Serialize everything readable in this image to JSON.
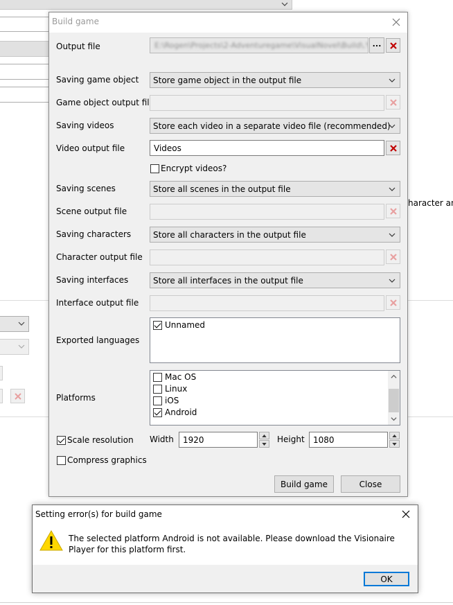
{
  "background": {
    "side_text": "haracter anir"
  },
  "window": {
    "title": "Build game",
    "output_file": {
      "label": "Output file",
      "value": "E:\\Rogen\\Projects\\2-Adventuregame\\VisualNovel\\Build\\.%"
    },
    "saving_game_object": {
      "label": "Saving game object",
      "value": "Store game object in the output file"
    },
    "game_object_output_file": {
      "label": "Game object output file",
      "value": ""
    },
    "saving_videos": {
      "label": "Saving videos",
      "value": "Store each video in a separate video file (recommended)"
    },
    "video_output_file": {
      "label": "Video output file",
      "value": "Videos"
    },
    "encrypt_videos": {
      "label": "Encrypt videos?",
      "checked": false
    },
    "saving_scenes": {
      "label": "Saving scenes",
      "value": "Store all scenes in the output file"
    },
    "scene_output_file": {
      "label": "Scene output file",
      "value": ""
    },
    "saving_characters": {
      "label": "Saving characters",
      "value": "Store all characters in the output file"
    },
    "character_output_file": {
      "label": "Character output file",
      "value": ""
    },
    "saving_interfaces": {
      "label": "Saving interfaces",
      "value": "Store all interfaces in the output file"
    },
    "interface_output_file": {
      "label": "Interface output file",
      "value": ""
    },
    "exported_languages": {
      "label": "Exported languages",
      "items": [
        {
          "label": "Unnamed",
          "checked": true
        }
      ]
    },
    "platforms": {
      "label": "Platforms",
      "items": [
        {
          "label": "Mac OS",
          "checked": false
        },
        {
          "label": "Linux",
          "checked": false
        },
        {
          "label": "iOS",
          "checked": false
        },
        {
          "label": "Android",
          "checked": true
        }
      ]
    },
    "scale_resolution": {
      "label": "Scale resolution",
      "checked": true
    },
    "width": {
      "label": "Width",
      "value": "1920"
    },
    "height": {
      "label": "Height",
      "value": "1080"
    },
    "compress_graphics": {
      "label": "Compress graphics",
      "checked": false
    },
    "build_button": "Build game",
    "close_button": "Close"
  },
  "error_dialog": {
    "title": "Setting error(s) for build game",
    "message": "The selected platform Android is not available. Please download the Visionaire Player for this platform first.",
    "ok_button": "OK"
  },
  "colors": {
    "window_bg": "#f0f0f0",
    "clear_icon": "#c00000",
    "ok_focus": "#0078d7",
    "warning": "#ffd700"
  }
}
